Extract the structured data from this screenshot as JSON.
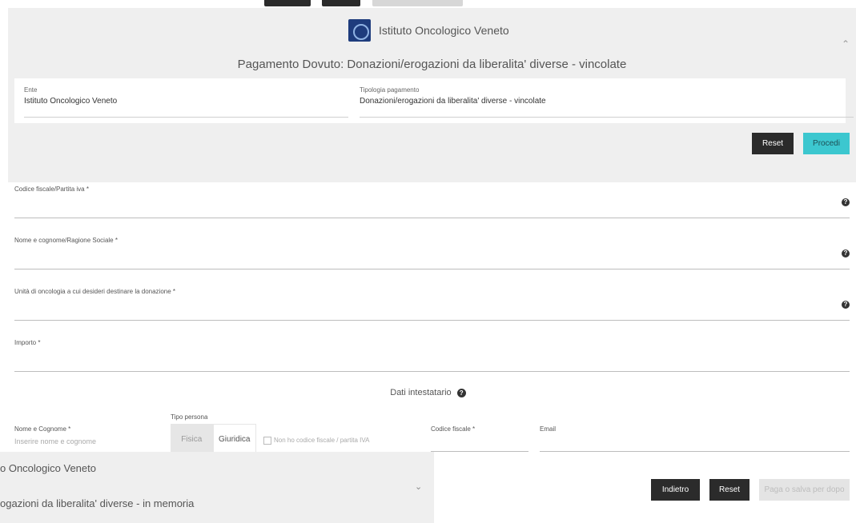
{
  "brand": {
    "name": "Istituto Oncologico Veneto"
  },
  "payment": {
    "title": "Pagamento Dovuto: Donazioni/erogazioni da liberalita' diverse - vincolate",
    "ente_label": "Ente",
    "ente_value": "Istituto Oncologico Veneto",
    "tipo_label": "Tipologia pagamento",
    "tipo_value": "Donazioni/erogazioni da liberalita' diverse - vincolate"
  },
  "panel_buttons": {
    "reset": "Reset",
    "proceed": "Procedi"
  },
  "form": {
    "codice_fiscale_label": "Codice fiscale/Partita iva *",
    "nome_label": "Nome e cognome/Ragione Sociale *",
    "unita_label": "Unità di oncologia a cui desideri destinare la donazione *",
    "importo_label": "Importo *"
  },
  "intestatario": {
    "title": "Dati intestatario",
    "nome_label": "Nome e Cognome *",
    "nome_placeholder": "Inserire nome e cognome",
    "tipo_persona_label": "Tipo persona",
    "fisica": "Fisica",
    "giuridica": "Giuridica",
    "no_cf_label": "Non ho codice fiscale / partita IVA",
    "codice_fiscale_label": "Codice fiscale *",
    "email_label": "Email"
  },
  "bottom_buttons": {
    "back": "Indietro",
    "reset": "Reset",
    "pay": "Paga o salva per dopo"
  },
  "overlay": {
    "line1": "o Oncologico Veneto",
    "line2": "ogazioni da liberalita' diverse - in memoria"
  },
  "colors": {
    "accent": "#3cc7cf",
    "dark_button": "#2b2b2b",
    "panel_bg": "#efefef"
  }
}
